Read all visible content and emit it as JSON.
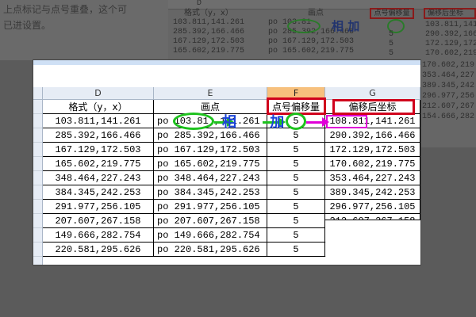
{
  "background": {
    "doc_lines": [
      "上点标记与点号重叠，这个可",
      "已进设置。"
    ],
    "sheet_header_label": "D",
    "sheet_col_e": "画点",
    "sheet_rows_left": [
      "103.811,141.261",
      "285.392,166.466",
      "167.129,172.503",
      "165.602,219.775"
    ],
    "sheet_rows_mid": [
      "po 103.81",
      "po 285.392,166.466",
      "po 167.129,172.503",
      "po 165.602,219.775"
    ],
    "sheet_rows_right": [
      "103.811,141.2",
      "290.392,166.",
      "172.129,172.",
      "170.602,219.",
      "353.464,227.",
      "389.345,242.",
      "296.977,256.",
      "212.607,267.",
      "154.666,282."
    ],
    "sheet_header_f": "点号偏移量",
    "sheet_header_g": "偏移后坐标"
  },
  "columns": [
    {
      "letter": "D",
      "active": false
    },
    {
      "letter": "E",
      "active": false
    },
    {
      "letter": "F",
      "active": true
    },
    {
      "letter": "G",
      "active": false
    }
  ],
  "row_numbers": [
    "",
    "",
    "",
    "",
    "",
    "",
    "",
    "",
    "",
    "",
    ""
  ],
  "headers": {
    "d": "格式（y，x）",
    "e": "画点",
    "f": "点号偏移量",
    "g": "偏移后坐标"
  },
  "rows": [
    {
      "d": "103.811,141.261",
      "e": "po 103.81 ,141.261",
      "f": "5",
      "g": "108.811,141.261"
    },
    {
      "d": "285.392,166.466",
      "e": "po 285.392,166.466",
      "f": "5",
      "g": "290.392,166.466"
    },
    {
      "d": "167.129,172.503",
      "e": "po 167.129,172.503",
      "f": "5",
      "g": "172.129,172.503"
    },
    {
      "d": "165.602,219.775",
      "e": "po 165.602,219.775",
      "f": "5",
      "g": "170.602,219.775"
    },
    {
      "d": "348.464,227.243",
      "e": "po 348.464,227.243",
      "f": "5",
      "g": "353.464,227.243"
    },
    {
      "d": "384.345,242.253",
      "e": "po 384.345,242.253",
      "f": "5",
      "g": "389.345,242.253"
    },
    {
      "d": "291.977,256.105",
      "e": "po 291.977,256.105",
      "f": "5",
      "g": "296.977,256.105"
    },
    {
      "d": "207.607,267.158",
      "e": "po 207.607,267.158",
      "f": "5",
      "g": "212.607,267.158"
    },
    {
      "d": "149.666,282.754",
      "e": "po 149.666,282.754",
      "f": "5",
      "g": ""
    },
    {
      "d": "220.581,295.626",
      "e": "po 220.581,295.626",
      "f": "5",
      "g": ""
    }
  ],
  "annotations": {
    "plus_text": "相 加",
    "colors": {
      "red": "#d0001c",
      "green": "#1ec21e",
      "magenta": "#e000d8",
      "blue": "#1a44d8"
    }
  }
}
